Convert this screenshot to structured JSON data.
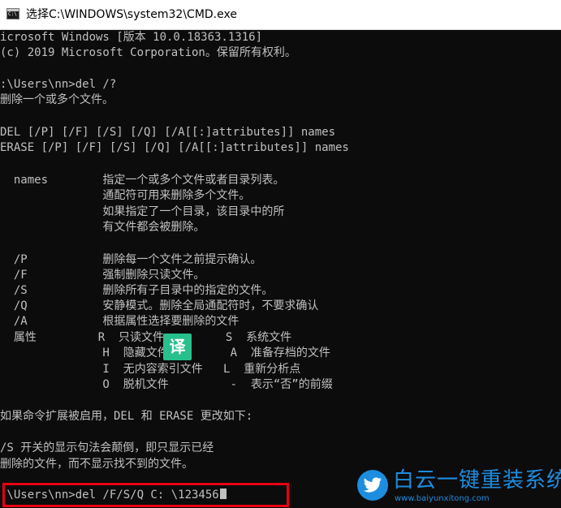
{
  "window": {
    "title": "选择C:\\WINDOWS\\system32\\CMD.exe",
    "icon": "cmd-icon"
  },
  "console": {
    "lines": [
      "icrosoft Windows [版本 10.0.18363.1316]",
      "(c) 2019 Microsoft Corporation。保留所有权利。",
      "",
      ":\\Users\\nn>del /?",
      "删除一个或多个文件。",
      "",
      "DEL [/P] [/F] [/S] [/Q] [/A[[:]attributes]] names",
      "ERASE [/P] [/F] [/S] [/Q] [/A[[:]attributes]] names",
      "",
      "  names        指定一个或多个文件或者目录列表。",
      "               通配符可用来删除多个文件。",
      "               如果指定了一个目录，该目录中的所",
      "               有文件都会被删除。",
      "",
      "  /P           删除每一个文件之前提示确认。",
      "  /F           强制删除只读文件。",
      "  /S           删除所有子目录中的指定的文件。",
      "  /Q           安静模式。删除全局通配符时，不要求确认",
      "  /A           根据属性选择要删除的文件",
      "  属性         R  只读文件         S  系统文件",
      "               H  隐藏文件         A  准备存档的文件",
      "               I  无内容索引文件   L  重新分析点",
      "               O  脱机文件         -  表示“否”的前缀",
      "",
      "如果命令扩展被启用，DEL 和 ERASE 更改如下:",
      "",
      "/S 开关的显示句法会颠倒，即只显示已经",
      "删除的文件，而不显示找不到的文件。",
      "",
      ":\\Users\\nn>del /F/S/Q C: \\123456"
    ],
    "text_color": "#c0c0c0",
    "background": "#0c0c0c"
  },
  "overlay": {
    "translate_badge": "译",
    "highlight_color": "#e60012",
    "badge_color": "#27c08c"
  },
  "watermark": {
    "name": "白云一键重装系统",
    "url": "www.baiyunxitong.com",
    "logo_icon": "twitter-bird-icon",
    "color": "#1d8ddf"
  }
}
